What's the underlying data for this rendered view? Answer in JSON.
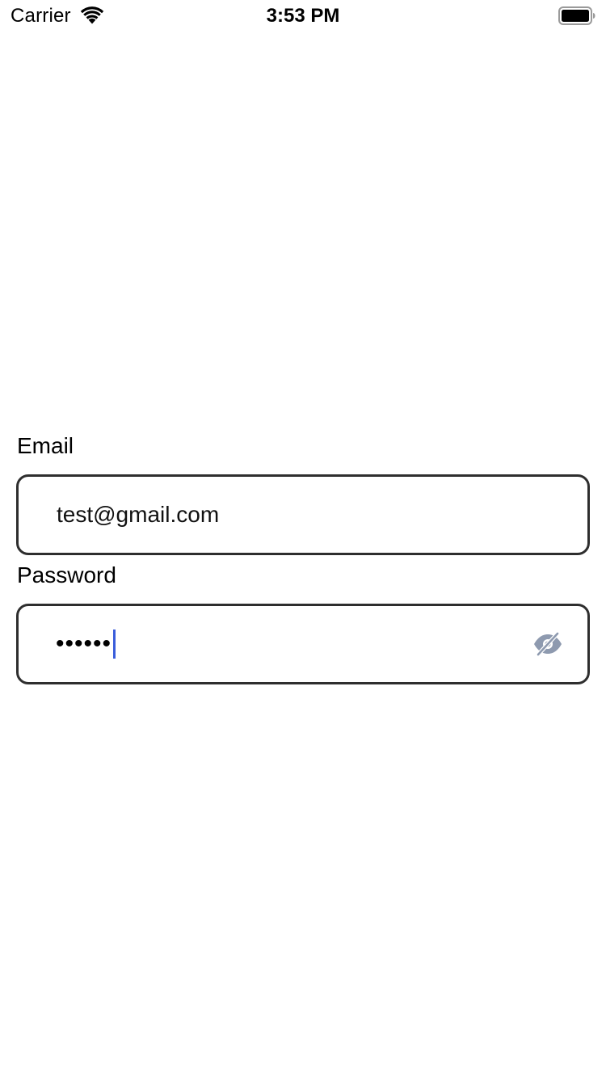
{
  "status_bar": {
    "carrier": "Carrier",
    "time": "3:53 PM",
    "icons": [
      "wifi-icon",
      "battery-icon"
    ]
  },
  "form": {
    "email": {
      "label": "Email",
      "value": "test@gmail.com"
    },
    "password": {
      "label": "Password",
      "masked_value": "••••••",
      "visibility_icon": "eye-slash-icon"
    }
  },
  "colors": {
    "background": "#ffffff",
    "input_border": "#2e2e2e",
    "caret": "#3a5ddb",
    "eye_icon": "#8e9aaf"
  }
}
